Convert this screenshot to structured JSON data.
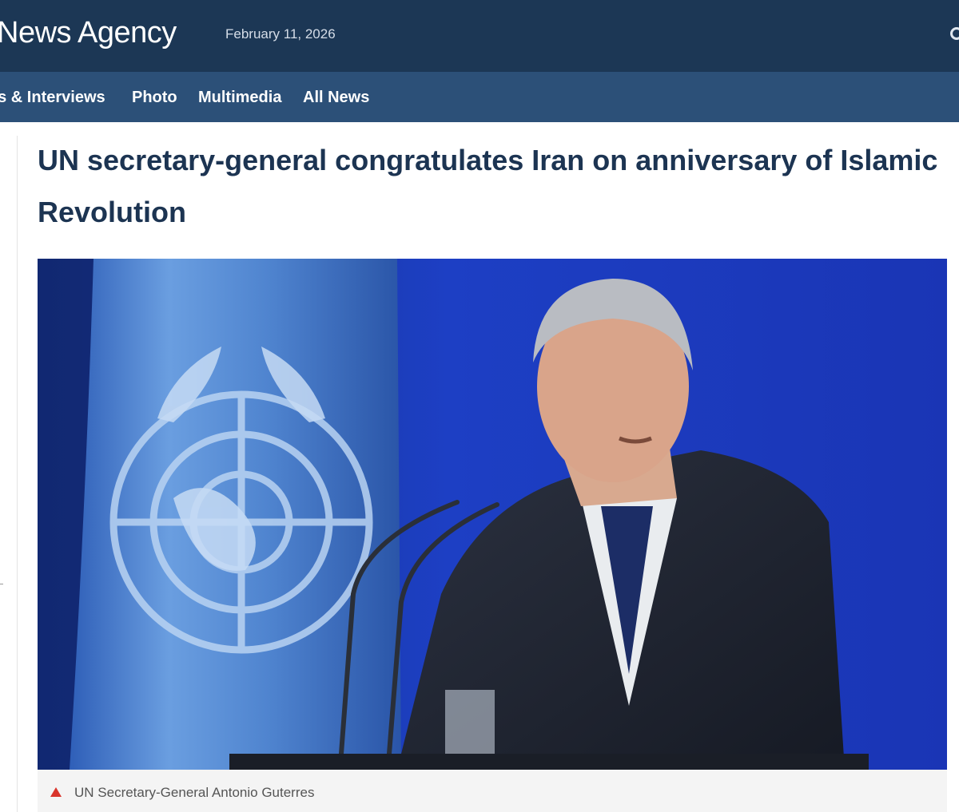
{
  "header": {
    "site_title": "News Agency",
    "date": "February 11, 2026",
    "search_icon": "search-icon"
  },
  "nav": {
    "items": [
      {
        "label": "vs & Interviews"
      },
      {
        "label": "Photo"
      },
      {
        "label": "Multimedia"
      },
      {
        "label": "All News"
      }
    ]
  },
  "article": {
    "headline": "UN secretary-general congratulates Iran on anniversary of Islamic Revolution",
    "photo_caption": "UN Secretary-General Antonio Guterres"
  },
  "colors": {
    "header_bg": "#1c3755",
    "nav_bg": "#2c5078",
    "headline_text": "#1c3452",
    "caption_marker": "#d9342b",
    "photo_backdrop": "#1b37b8",
    "un_flag_blue": "#5b90d6"
  }
}
